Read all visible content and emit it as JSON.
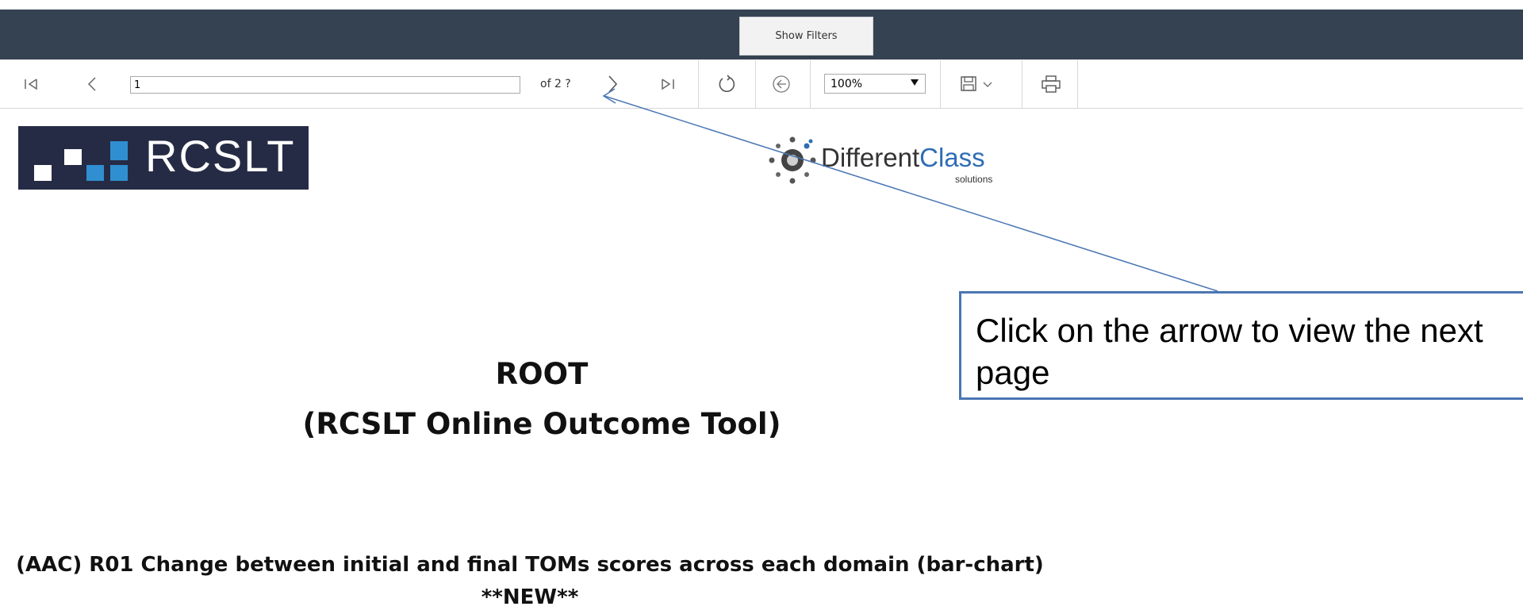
{
  "header": {
    "show_filters_label": "Show Filters"
  },
  "toolbar": {
    "current_page": "1",
    "of_pages": "of 2 ?",
    "zoom": "100%",
    "icons": [
      "first-page-icon",
      "previous-page-icon",
      "next-page-icon",
      "last-page-icon",
      "refresh-icon",
      "back-icon",
      "save-icon",
      "print-icon"
    ]
  },
  "logos": {
    "rcslt": "RCSLT",
    "dc_part1": "Different",
    "dc_part2": "Class",
    "dc_sub": "solutions"
  },
  "report": {
    "title_line1": "ROOT",
    "title_line2": "(RCSLT Online Outcome Tool)",
    "report_title": "(AAC) R01 Change between initial and final TOMs scores across each domain (bar-chart) **NEW**"
  },
  "callout": {
    "text": "Click on the arrow to view the next page"
  },
  "colors": {
    "topbar": "#354252",
    "callout_border": "#4a76b4",
    "rcslt_bg": "#262b45",
    "dc_blue": "#2f6db5"
  }
}
